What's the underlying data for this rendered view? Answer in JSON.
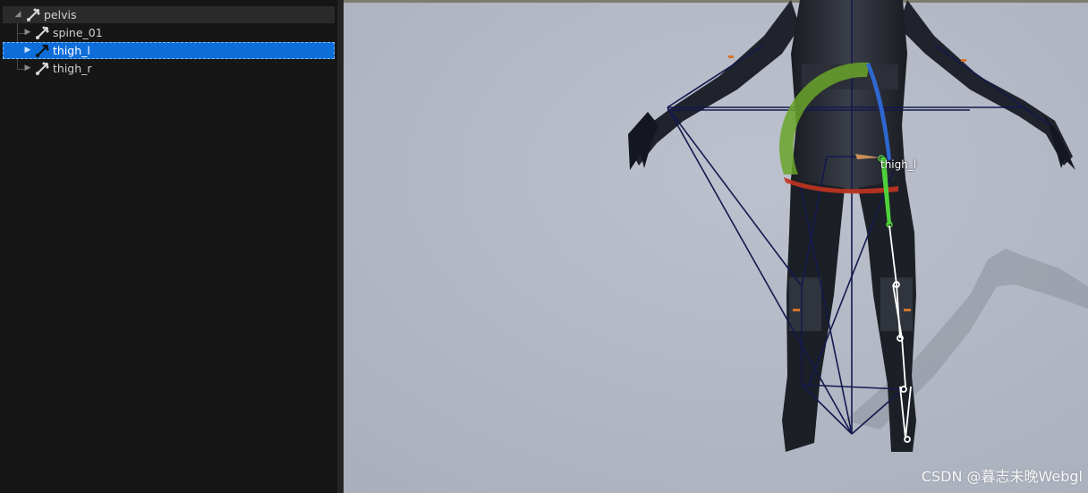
{
  "tree": {
    "cut_row_label": "",
    "items": [
      {
        "label": "pelvis",
        "expanded": true,
        "selected": false
      },
      {
        "label": "spine_01",
        "expanded": false,
        "selected": false
      },
      {
        "label": "thigh_l",
        "expanded": false,
        "selected": true
      },
      {
        "label": "thigh_r",
        "expanded": false,
        "selected": false
      }
    ]
  },
  "viewport": {
    "bone_label": "thigh_l",
    "colors": {
      "background": "#b4b9c6",
      "skeleton_lines": "#14194d",
      "selected_bone": "#4ed23b",
      "child_bones": "#ffffff",
      "rotate_x": "#c23420",
      "rotate_y": "#6aa52a",
      "rotate_z": "#2e6ad8"
    }
  },
  "watermark": "CSDN @暮志未晚Webgl"
}
